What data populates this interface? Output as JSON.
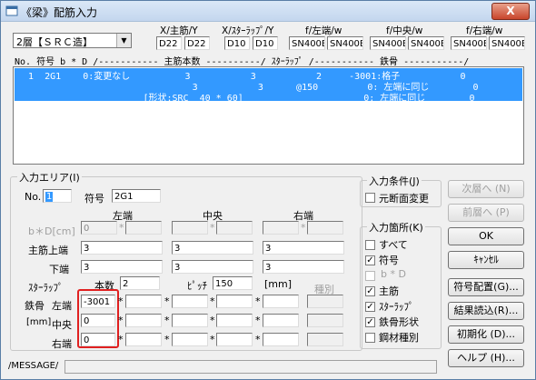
{
  "window": {
    "title": "《梁》配筋入力",
    "close_label": "X"
  },
  "floor_select": {
    "value": "2層【ＳＲＣ造】"
  },
  "header_groups": [
    {
      "label": "X/主筋/Y",
      "left": "D22",
      "right": "D22"
    },
    {
      "label": "X/ｽﾀｰﾗｯﾌﾟ/Y",
      "left": "D10",
      "right": "D10"
    },
    {
      "label": "f/左端/w",
      "left": "SN400B",
      "right": "SN400B"
    },
    {
      "label": "f/中央/w",
      "left": "SN400B",
      "right": "SN400B"
    },
    {
      "label": "f/右端/w",
      "left": "SN400B",
      "right": "SN400B"
    }
  ],
  "list_header": "No.   符号   b * D   /----------- 主筋本数 ----------/  ｽﾀｰﾗｯﾌﾟ /----------- 鉄骨 -----------/",
  "list_rows": [
    "  1  2G1    0:変更なし          3           3           2     -3001:格子           0",
    "                                3           3      @150         0: 左端に同じ        0",
    "                       [形状:SRC  40 * 60]                      0: 左端に同じ        0"
  ],
  "input_area": {
    "title": "入力エリア(I)",
    "no_label": "No.",
    "no_value": "1",
    "fugo_label": "符号",
    "fugo_value": "2G1",
    "col_left": "左端",
    "col_center": "中央",
    "col_right": "右端",
    "bd_label": "b＊D[cm]",
    "bd_left_b": "0",
    "star": "*",
    "main_top_label": "主筋上端",
    "main_top": [
      "3",
      "3",
      "3"
    ],
    "main_bottom_label": "下端",
    "main_bottom": [
      "3",
      "3",
      "3"
    ],
    "stirrup_label": "ｽﾀｰﾗｯﾌﾟ",
    "count_label": "本数",
    "count_value": "2",
    "pitch_label": "ﾋﾟｯﾁ",
    "pitch_value": "150",
    "mm_label": "[mm]",
    "shubetsu_label": "種別",
    "steel_label": "鉄骨",
    "steel_mm": "[mm]",
    "steel_left_label": "左端",
    "steel_center_label": "中央",
    "steel_right_label": "右端",
    "steel_values": [
      "-3001",
      "0",
      "0"
    ]
  },
  "input_condition": {
    "title": "入力条件(J)",
    "section_change": "元断面変更"
  },
  "input_location": {
    "title": "入力箇所(K)",
    "items": [
      {
        "label": "すべて",
        "checked": false,
        "enabled": true
      },
      {
        "label": "符号",
        "checked": true,
        "enabled": true
      },
      {
        "label": "b * D",
        "checked": false,
        "enabled": false
      },
      {
        "label": "主筋",
        "checked": true,
        "enabled": true
      },
      {
        "label": "ｽﾀｰﾗｯﾌﾟ",
        "checked": true,
        "enabled": true
      },
      {
        "label": "鉄骨形状",
        "checked": true,
        "enabled": true
      },
      {
        "label": "鋼材種別",
        "checked": false,
        "enabled": true
      }
    ]
  },
  "buttons": {
    "next": "次層へ (N)",
    "prev": "前層へ (P)",
    "ok": "OK",
    "cancel": "ｷｬﾝｾﾙ",
    "sign_layout": "符号配置(G)...",
    "load_result": "結果読込(R)...",
    "init": "初期化 (D)...",
    "help": "ヘルプ (H)..."
  },
  "status": {
    "label": "/MESSAGE/"
  }
}
